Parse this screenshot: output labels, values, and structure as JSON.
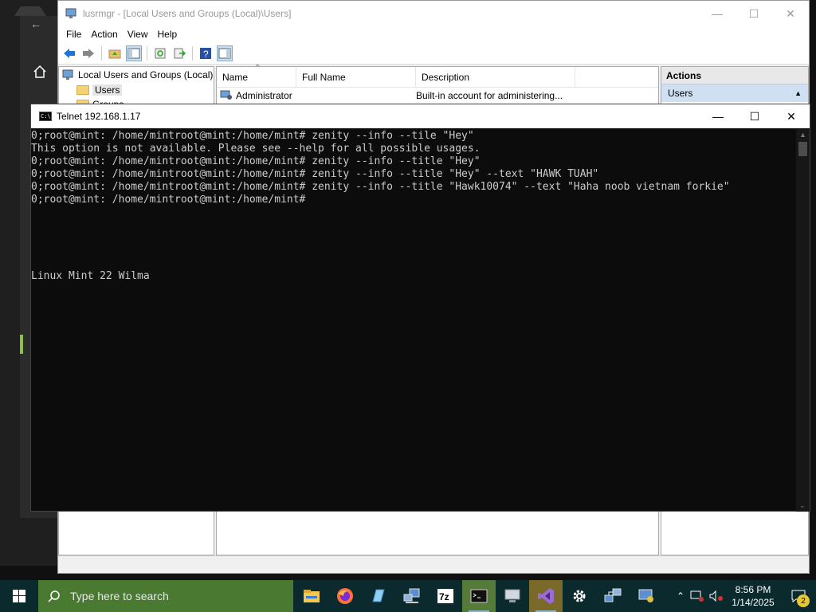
{
  "mmc": {
    "title": "lusrmgr - [Local Users and Groups (Local)\\Users]",
    "menu": [
      "File",
      "Action",
      "View",
      "Help"
    ],
    "tree": {
      "root": "Local Users and Groups (Local)",
      "children": [
        "Users",
        "Groups"
      ]
    },
    "columns": [
      "Name",
      "Full Name",
      "Description"
    ],
    "rows": [
      {
        "name": "Administrator",
        "full_name": "",
        "description": "Built-in account for administering..."
      }
    ],
    "actions": {
      "header": "Actions",
      "section": "Users"
    }
  },
  "telnet": {
    "title": "Telnet 192.168.1.17",
    "lines": [
      "0;root@mint: /home/mintroot@mint:/home/mint# zenity --info --tile \"Hey\"",
      "This option is not available. Please see --help for all possible usages.",
      "0;root@mint: /home/mintroot@mint:/home/mint# zenity --info --title \"Hey\"",
      "0;root@mint: /home/mintroot@mint:/home/mint# zenity --info --title \"Hey\" --text \"HAWK TUAH\"",
      "0;root@mint: /home/mintroot@mint:/home/mint# zenity --info --title \"Hawk10074\" --text \"Haha noob vietnam forkie\"",
      "0;root@mint: /home/mintroot@mint:/home/mint#",
      "",
      "",
      "",
      "",
      "",
      "Linux Mint 22 Wilma"
    ]
  },
  "taskbar": {
    "search_placeholder": "Type here to search",
    "time": "8:56 PM",
    "date": "1/14/2025",
    "notification_count": "2"
  }
}
